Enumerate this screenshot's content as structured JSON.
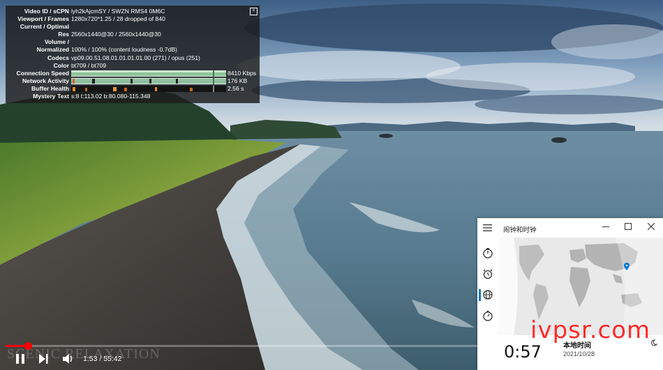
{
  "stats": {
    "close_label": "[x]",
    "rows": [
      {
        "label": "Video ID / sCPN",
        "value": "lyh2kAjcmSY / SWZN RMS4 0M6C"
      },
      {
        "label": "Viewport / Frames",
        "value": "1280x720*1.25 / 28 dropped of 840"
      },
      {
        "label": "Current / Optimal",
        "value": ""
      },
      {
        "label": "Res",
        "value": "2560x1440@30 / 2560x1440@30"
      },
      {
        "label": "Volume /",
        "value": ""
      },
      {
        "label": "Normalized",
        "value": "100% / 100% (content loudness -0.7dB)"
      },
      {
        "label": "Codecs",
        "value": "vp09.00.51.08.01.01.01.01.00 (271) / opus (251)"
      },
      {
        "label": "Color",
        "value": "bt709 / bt709"
      }
    ],
    "bars": [
      {
        "label": "Connection Speed",
        "value": "8410 Kbps"
      },
      {
        "label": "Network Activity",
        "value": "176 KB"
      },
      {
        "label": "Buffer Health",
        "value": "2.56 s"
      }
    ],
    "mystery": {
      "label": "Mystery Text",
      "value": "s:8 t:113.02 b:80.080-115.348"
    }
  },
  "player": {
    "current_time": "1:53",
    "duration": "55:42",
    "time_separator": " / ",
    "progress_fraction": 0.034,
    "channel_watermark": "SCENIC RELAXATION",
    "accent": "#ff0000"
  },
  "clock_app": {
    "title": "闹钟和时钟",
    "nav_icons": [
      "timer-icon",
      "alarm-icon",
      "world-clock-icon",
      "stopwatch-icon"
    ],
    "active_nav": 2,
    "local_time": "0:57",
    "place": "本地时间",
    "date": "2021/10/28",
    "accent": "#0078d7"
  },
  "site_watermark": "ivpsr.com"
}
